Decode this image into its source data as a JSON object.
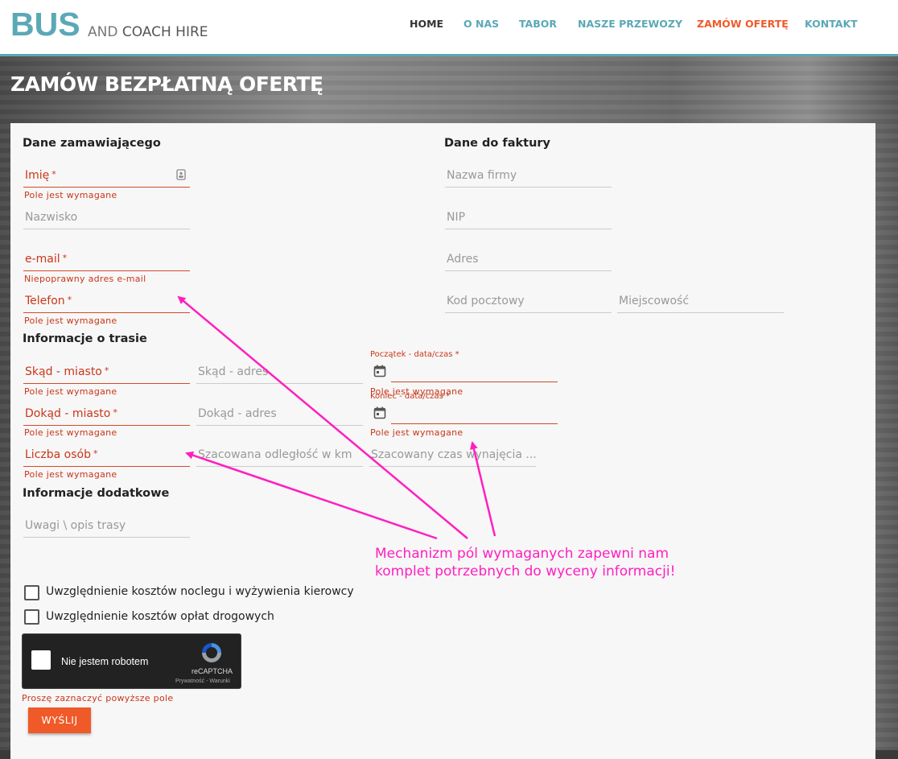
{
  "logo": {
    "big": "BUS",
    "small_and": "AND",
    "small_rest": "COACH HIRE"
  },
  "nav": [
    {
      "label": "HOME",
      "state": "home"
    },
    {
      "label": "O NAS",
      "state": "normal"
    },
    {
      "label": "TABOR",
      "state": "normal"
    },
    {
      "label": "NASZE PRZEWOZY",
      "state": "normal"
    },
    {
      "label": "ZAMÓW OFERTĘ",
      "state": "active"
    },
    {
      "label": "KONTAKT",
      "state": "normal"
    }
  ],
  "page_title": "ZAMÓW BEZPŁATNĄ OFERTĘ",
  "sections": {
    "orderer": "Dane zamawiającego",
    "invoice": "Dane do faktury",
    "route": "Informacje o trasie",
    "extra": "Informacje dodatkowe"
  },
  "orderer": {
    "first_name": {
      "label": "Imię",
      "required": "*",
      "error": "Pole jest wymagane"
    },
    "last_name": {
      "label": "Nazwisko"
    },
    "email": {
      "label": "e-mail",
      "required": "*",
      "error": "Niepoprawny adres e-mail"
    },
    "phone": {
      "label": "Telefon",
      "required": "*",
      "error": "Pole jest wymagane"
    }
  },
  "invoice": {
    "company": {
      "label": "Nazwa firmy"
    },
    "nip": {
      "label": "NIP"
    },
    "address": {
      "label": "Adres"
    },
    "postal": {
      "label": "Kod pocztowy"
    },
    "city": {
      "label": "Miejscowość"
    }
  },
  "route": {
    "from_city": {
      "label": "Skąd - miasto",
      "required": "*",
      "error": "Pole jest wymagane"
    },
    "from_address": {
      "label": "Skąd - adres"
    },
    "start": {
      "label": "Początek - data/czas",
      "required": "*",
      "error": "Pole jest wymagane"
    },
    "to_city": {
      "label": "Dokąd - miasto",
      "required": "*",
      "error": "Pole jest wymagane"
    },
    "to_address": {
      "label": "Dokąd - adres"
    },
    "end": {
      "label": "Koniec - data/czas",
      "required": "*",
      "error": "Pole jest wymagane"
    },
    "people": {
      "label": "Liczba osób",
      "required": "*",
      "error": "Pole jest wymagane"
    },
    "distance": {
      "label": "Szacowana odległość w km"
    },
    "duration": {
      "label": "Szacowany czas wynajęcia ..."
    }
  },
  "extra": {
    "notes": {
      "label": "Uwagi \\ opis trasy"
    },
    "cb_lodging": "Uwzględnienie kosztów noclegu i wyżywienia kierowcy",
    "cb_tolls": "Uwzględnienie kosztów opłat drogowych"
  },
  "recaptcha": {
    "text": "Nie jestem robotem",
    "brand": "reCAPTCHA",
    "links": "Prywatność - Warunki",
    "error": "Proszę zaznaczyć powyższe pole"
  },
  "submit_label": "WYŚLIJ",
  "annotation": {
    "line1": "Mechanizm pól wymaganych zapewni nam",
    "line2": "komplet potrzebnych do wyceny informacji!",
    "color": "#ff1fc0"
  },
  "colors": {
    "accent": "#5ba8b6",
    "active": "#f05a28",
    "error": "#c9361a"
  }
}
